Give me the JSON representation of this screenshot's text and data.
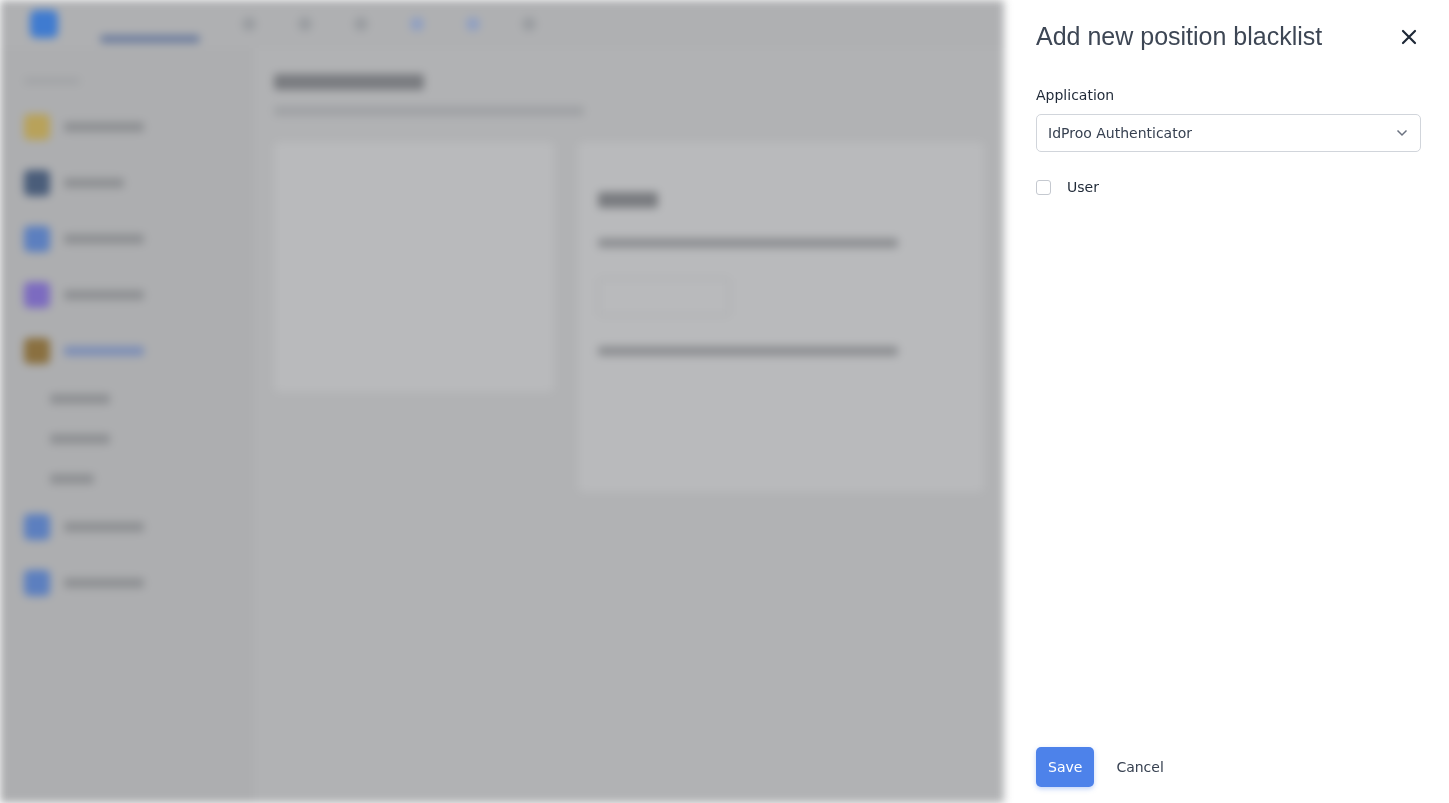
{
  "drawer": {
    "title": "Add new position blacklist",
    "fields": [
      {
        "kind": "select",
        "label": "Application",
        "value": "IdProo Authenticator"
      },
      {
        "kind": "checkbox",
        "label": "User",
        "checked": false
      }
    ],
    "buttons": [
      {
        "kind": "primary",
        "label": "Save"
      },
      {
        "kind": "plain",
        "label": "Cancel"
      }
    ]
  }
}
